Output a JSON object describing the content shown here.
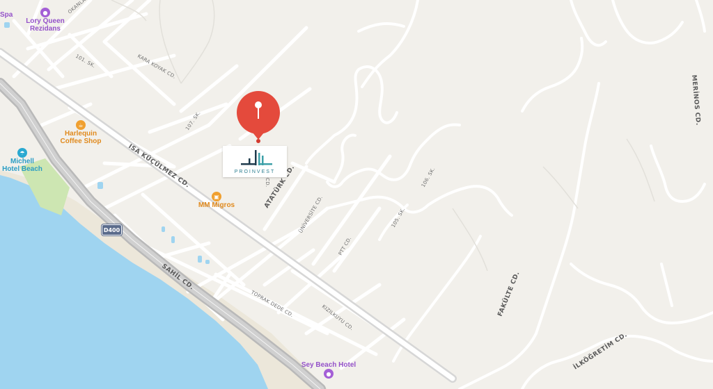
{
  "map": {
    "pois": {
      "spa": {
        "label": "Spa",
        "icon": "purple-circle-icon"
      },
      "lory_queen": {
        "label_line1": "Lory Queen",
        "label_line2": "Rezidans",
        "icon": "hotel-icon"
      },
      "harlequin": {
        "label_line1": "Harlequin",
        "label_line2": "Coffee Shop",
        "icon": "coffee-icon"
      },
      "michell": {
        "label_line1": "Michell",
        "label_line2": "Hotel Beach",
        "icon": "beach-umbrella-icon"
      },
      "mm_migros": {
        "label": "MM Migros",
        "icon": "shopping-basket-icon"
      },
      "sey_beach": {
        "label": "Sey Beach Hotel",
        "icon": "hotel-icon"
      }
    },
    "highway_shield": "D400",
    "streets": {
      "okanlar": "OKANLAR SK.",
      "sk101": "101. SK.",
      "kara_koyak": "KARA KOYAK CD.",
      "sk107": "107. SK.",
      "isa_kucukmez": "ISA KÜÇÜLMEZ CD.",
      "ataturk": "ATATÜRK CD.",
      "universite": "ÜNİVERSİTE CD.",
      "ptt": "PTT CD.",
      "sk105": "105. SK.",
      "sk106": "106. SK.",
      "sahil": "SAHİL CD.",
      "toprak_dede": "TOPRAK DEDE CD.",
      "kizilkuyu": "KIZILKUYU CD.",
      "fakulte": "FAKÜLTE CD.",
      "merinos": "MERİNOS CD.",
      "ilkogretim": "İLKÖĞRETİM CD.",
      "cd_short": "CD."
    },
    "marker": {
      "logo_text": "PROINVEST",
      "icon": "map-pin-icon"
    },
    "colors": {
      "land": "#f2f0eb",
      "water": "#9fd4f0",
      "road": "#ffffff",
      "highway": "#c9c9c9",
      "park": "#cde6b2",
      "pin": "#e44a3c",
      "beach": "#ece7da"
    }
  }
}
